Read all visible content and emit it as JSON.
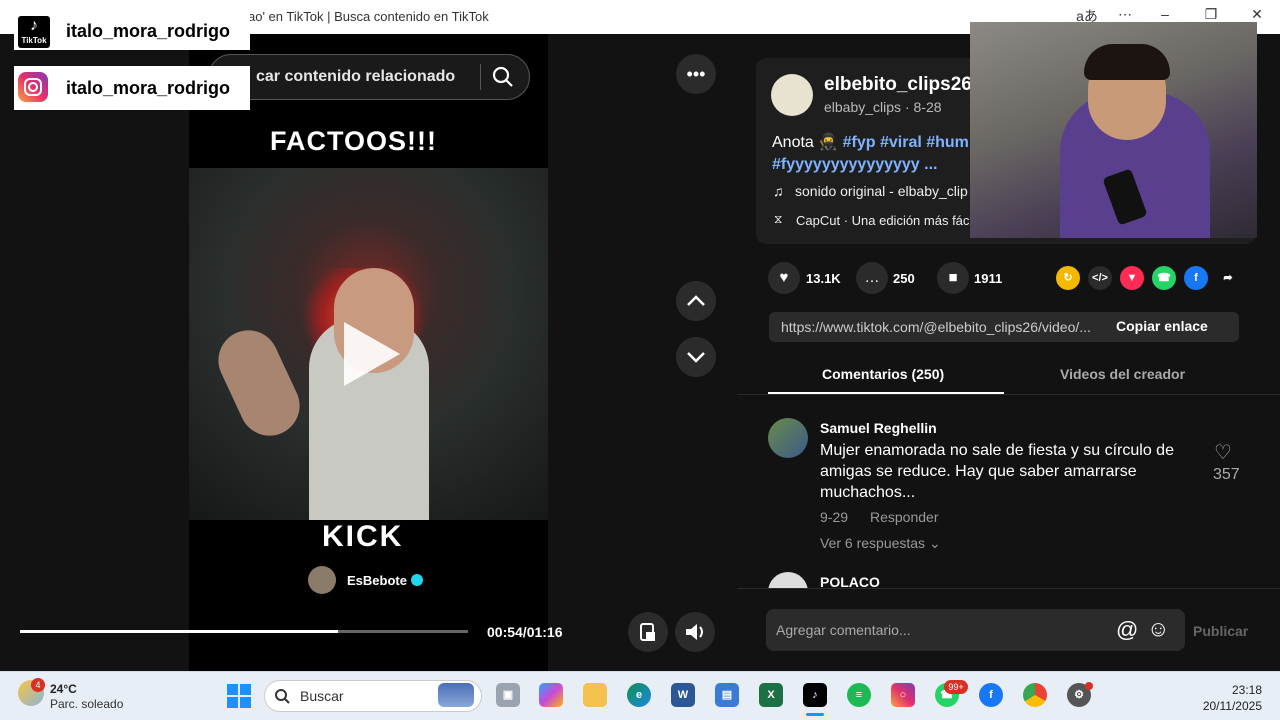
{
  "browser": {
    "tab_title": "ao' en TikTok | Busca contenido en TikTok",
    "translate_icon": "translate-icon",
    "menu_icon": "more-icon"
  },
  "overlays": {
    "tiktok_handle": "italo_mora_rodrigo",
    "tiktok_logo_text": "TikTok",
    "instagram_handle": "italo_mora_rodrigo"
  },
  "search": {
    "text": "car contenido relacionado"
  },
  "video": {
    "top_text": "FACTOOS!!!",
    "kick_text": "KICK",
    "creator_label": "EsBebote",
    "current_time": "00:54/01:16",
    "progress": 0.71
  },
  "post": {
    "handle": "elbebito_clips26",
    "subhandle": "elbaby_clips · 8-28",
    "caption_prefix": "Anota",
    "caption_tags_line1": "#fyp #viral #hum",
    "caption_tags_line2": "#fyyyyyyyyyyyyyyy ...",
    "music": "sonido original - elbaby_clip",
    "capcut": "CapCut · Una edición más fác"
  },
  "stats": {
    "likes": "13.1K",
    "comments": "250",
    "saves": "1911"
  },
  "share": {
    "link": "https://www.tiktok.com/@elbebito_clips26/video/...",
    "copy_label": "Copiar enlace"
  },
  "tabs": {
    "comments": "Comentarios (250)",
    "creator_videos": "Videos del creador"
  },
  "comments": [
    {
      "name": "Samuel Reghellin",
      "text": "Mujer enamorada no sale de fiesta y su círculo de amigas se reduce. Hay que saber amarrarse muchachos...",
      "date": "9-29",
      "reply": "Responder",
      "replies": "Ver 6 respuestas",
      "likes": "357"
    },
    {
      "name": "POLACO"
    }
  ],
  "comment_box": {
    "placeholder": "Agregar comentario...",
    "publish": "Publicar"
  },
  "taskbar": {
    "weather_temp": "24°C",
    "weather_desc": "Parc. soleado",
    "weather_badge": "4",
    "search": "Buscar",
    "whatsapp_badge": "99+",
    "time": "23:18",
    "date": "20/11/2025"
  },
  "colors": {
    "hashtag": "#7fb3ff",
    "accent": "#fe2c55",
    "verified": "#20d5ec"
  }
}
